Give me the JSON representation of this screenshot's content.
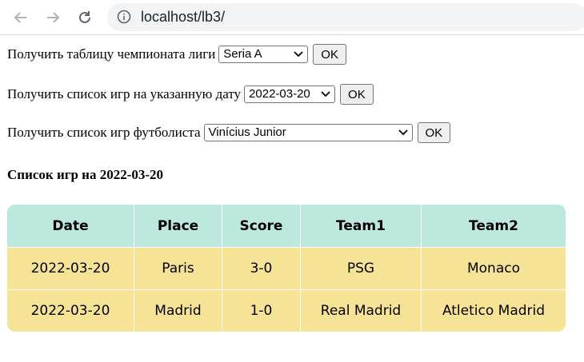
{
  "browser": {
    "url": "localhost/lb3/",
    "icons": [
      "back-arrow-icon",
      "forward-arrow-icon",
      "reload-icon",
      "info-icon"
    ]
  },
  "forms": [
    {
      "label": "Получить таблицу чемпионата лиги",
      "selected": "Seria A",
      "button": "OK"
    },
    {
      "label": "Получить список игр на указанную дату",
      "selected": "2022-03-20",
      "button": "OK"
    },
    {
      "label": "Получить список игр футболиста",
      "selected": "Vinícius Junior",
      "button": "OK"
    }
  ],
  "section_title": "Список игр на 2022-03-20",
  "table": {
    "headers": [
      "Date",
      "Place",
      "Score",
      "Team1",
      "Team2"
    ],
    "rows": [
      [
        "2022-03-20",
        "Paris",
        "3-0",
        "PSG",
        "Monaco"
      ],
      [
        "2022-03-20",
        "Madrid",
        "1-0",
        "Real Madrid",
        "Atletico Madrid"
      ]
    ]
  },
  "colors": {
    "header_bg": "#bde8dd",
    "row_bg": "#f7e395"
  }
}
